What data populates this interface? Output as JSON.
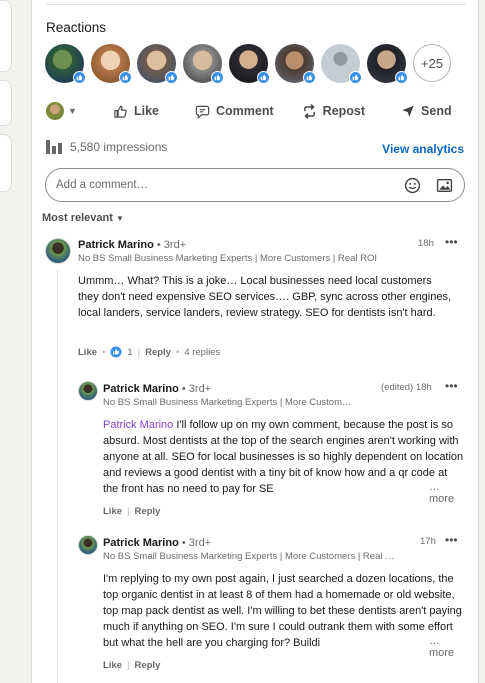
{
  "reactions": {
    "title": "Reactions",
    "more_count": "+25",
    "avatars": [
      {
        "name": "reactor-1",
        "c1": "#2c5b3a",
        "c2": "#7fb0d8"
      },
      {
        "name": "reactor-2",
        "c1": "#e8c9a8",
        "c2": "#b5774a"
      },
      {
        "name": "reactor-3",
        "c1": "#d7b89a",
        "c2": "#6f5b4a"
      },
      {
        "name": "reactor-4",
        "c1": "#cfb597",
        "c2": "#8a8a8a"
      },
      {
        "name": "reactor-5",
        "c1": "#d4b08f",
        "c2": "#2a2a30"
      },
      {
        "name": "reactor-6",
        "c1": "#b98e6a",
        "c2": "#5d5d66"
      },
      {
        "name": "reactor-7",
        "c1": "#a8b3bd",
        "c2": "#c5ccd3"
      },
      {
        "name": "reactor-8",
        "c1": "#c9a889",
        "c2": "#202228"
      }
    ]
  },
  "actions": {
    "like": "Like",
    "comment": "Comment",
    "repost": "Repost",
    "send": "Send"
  },
  "stats": {
    "impressions": "5,580 impressions",
    "analytics": "View analytics"
  },
  "comment_box": {
    "placeholder": "Add a comment…"
  },
  "sort": {
    "label": "Most relevant"
  },
  "comments": [
    {
      "author": "Patrick Marino",
      "degree": "• 3rd+",
      "headline": "No BS Small Business Marketing Experts | More Customers | Real ROI",
      "time": "18h",
      "text": "Ummm… What? This is a joke… Local businesses need local customers they don't need expensive SEO services…. GBP, sync across other engines, local landers, service landers, review strategy. SEO for dentists isn't hard.",
      "like": "Like",
      "like_count": "1",
      "reply": "Reply",
      "replies": "4 replies"
    },
    {
      "author": "Patrick Marino",
      "degree": "• 3rd+",
      "headline": "No BS Small Business Marketing Experts | More Custom…",
      "time": "(edited) 18h",
      "mention": "Patrick Marino",
      "text": " I'll follow up on my own comment, because the post is so absurd. Most dentists at the top of the search engines aren't working with anyone at all. SEO for local businesses is so highly dependent on location and reviews a good dentist with a tiny bit of know how and a qr code at the front has no need to pay for SE",
      "see_more": "…more",
      "like": "Like",
      "reply": "Reply"
    },
    {
      "author": "Patrick Marino",
      "degree": "• 3rd+",
      "headline": "No BS Small Business Marketing Experts | More Customers | Real …",
      "time": "17h",
      "text": "I'm replying to my own post again, I just searched a dozen locations, the top organic dentist in at least 8 of them had a homemade or old website, top map pack dentist as well. I'm willing to bet these dentists aren't paying much if anything on SEO. I'm sure I could outrank them with some effort but what the hell are you charging for? Buildi",
      "see_more": "…more",
      "like": "Like",
      "reply": "Reply"
    }
  ]
}
